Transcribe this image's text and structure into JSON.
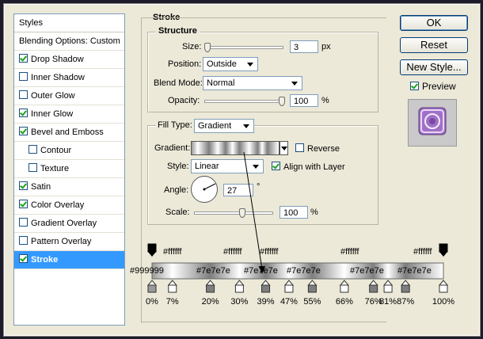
{
  "styles_panel": {
    "header": "Styles",
    "blending": "Blending Options: Custom",
    "items": [
      {
        "label": "Drop Shadow",
        "checked": true,
        "sub": false,
        "selected": false
      },
      {
        "label": "Inner Shadow",
        "checked": false,
        "sub": false,
        "selected": false
      },
      {
        "label": "Outer Glow",
        "checked": false,
        "sub": false,
        "selected": false
      },
      {
        "label": "Inner Glow",
        "checked": true,
        "sub": false,
        "selected": false
      },
      {
        "label": "Bevel and Emboss",
        "checked": true,
        "sub": false,
        "selected": false
      },
      {
        "label": "Contour",
        "checked": false,
        "sub": true,
        "selected": false
      },
      {
        "label": "Texture",
        "checked": false,
        "sub": true,
        "selected": false
      },
      {
        "label": "Satin",
        "checked": true,
        "sub": false,
        "selected": false
      },
      {
        "label": "Color Overlay",
        "checked": true,
        "sub": false,
        "selected": false
      },
      {
        "label": "Gradient Overlay",
        "checked": false,
        "sub": false,
        "selected": false
      },
      {
        "label": "Pattern Overlay",
        "checked": false,
        "sub": false,
        "selected": false
      },
      {
        "label": "Stroke",
        "checked": true,
        "sub": false,
        "selected": true
      }
    ]
  },
  "stroke": {
    "title": "Stroke",
    "structure_title": "Structure",
    "size_label": "Size:",
    "size_value": "3",
    "size_unit": "px",
    "position_label": "Position:",
    "position_value": "Outside",
    "blend_label": "Blend Mode:",
    "blend_value": "Normal",
    "opacity_label": "Opacity:",
    "opacity_value": "100",
    "opacity_unit": "%",
    "fill_type_label": "Fill Type:",
    "fill_type_value": "Gradient",
    "gradient_label": "Gradient:",
    "reverse_label": "Reverse",
    "reverse_checked": false,
    "style_label": "Style:",
    "style_value": "Linear",
    "align_label": "Align with Layer",
    "align_checked": true,
    "angle_label": "Angle:",
    "angle_value": "27",
    "angle_unit": "°",
    "scale_label": "Scale:",
    "scale_value": "100",
    "scale_unit": "%"
  },
  "buttons": {
    "ok": "OK",
    "reset": "Reset",
    "new_style": "New Style...",
    "preview_label": "Preview",
    "preview_checked": true
  },
  "gradient_annotation": {
    "top_colors": [
      "#ffffff",
      "#ffffff",
      "#ffffff",
      "#ffffff",
      "#ffffff"
    ],
    "bottom_colors": [
      "#999999",
      "#7e7e7e",
      "#7e7e7e",
      "#7e7e7e",
      "#7e7e7e",
      "#7e7e7e"
    ],
    "stops": [
      "0%",
      "7%",
      "20%",
      "30%",
      "39%",
      "47%",
      "55%",
      "66%",
      "76%",
      "81%",
      "87%",
      "100%"
    ]
  }
}
